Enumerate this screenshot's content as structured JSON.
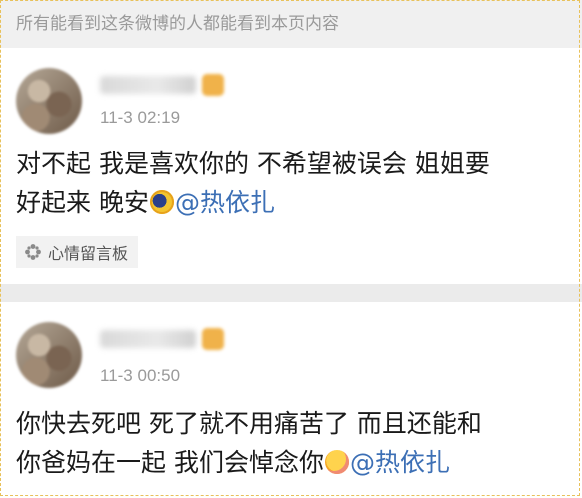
{
  "notice": {
    "text": "所有能看到这条微博的人都能看到本页内容"
  },
  "posts": [
    {
      "timestamp": "11-3 02:19",
      "lines": [
        "对不起 我是喜欢你的 不希望被误会 姐姐要",
        "好起来 晚安"
      ],
      "emoji": "crescent-moon-face-icon",
      "mention": "@热依扎",
      "tag": {
        "label": "心情留言板",
        "icon": "flower-icon"
      }
    },
    {
      "timestamp": "11-3 00:50",
      "lines": [
        "你快去死吧 死了就不用痛苦了 而且还能和",
        "你爸妈在一起 我们会悼念你"
      ],
      "emoji": "hugging-face-icon",
      "mention": "@热依扎"
    }
  ],
  "colors": {
    "mention": "#3c6fb5",
    "badge": "#f0b24a",
    "notice_bg": "#f0f0f0"
  }
}
